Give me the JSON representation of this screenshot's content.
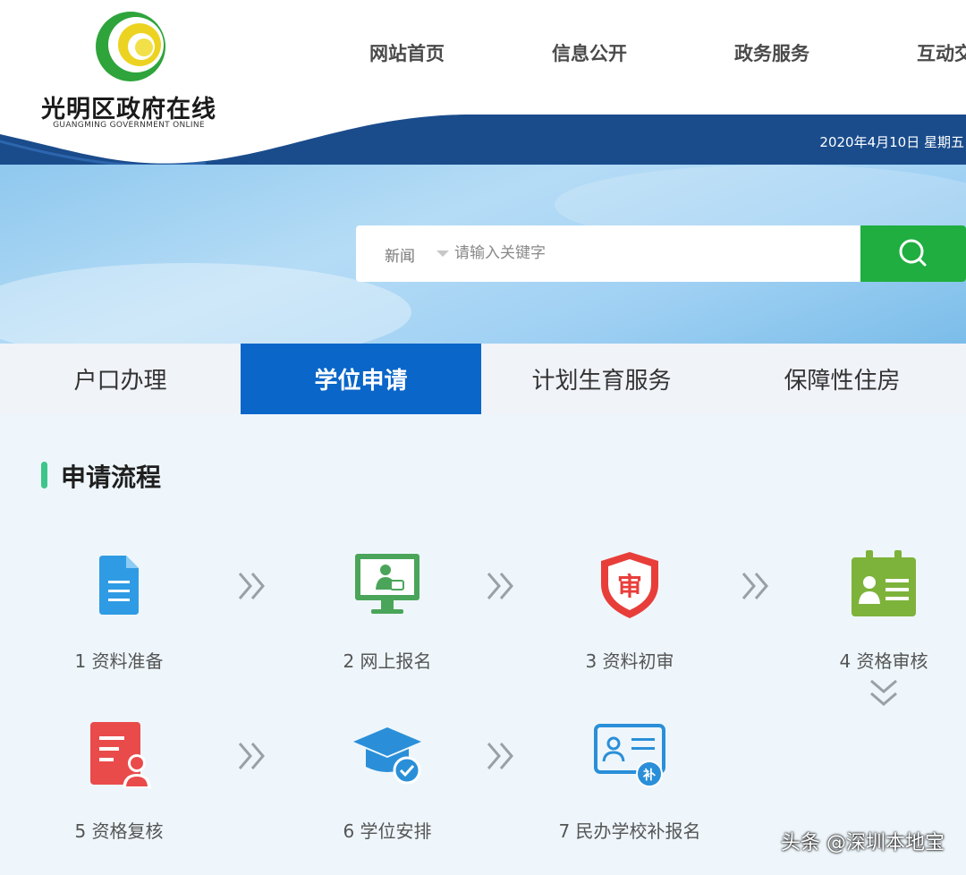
{
  "header": {
    "logo_title": "光明区政府在线",
    "logo_subtitle": "GUANGMING GOVERNMENT ONLINE",
    "nav": [
      "网站首页",
      "信息公开",
      "政务服务",
      "互动交"
    ],
    "date": "2020年4月10日 星期五"
  },
  "search": {
    "scope": "新闻",
    "placeholder": "请输入关键字",
    "value": ""
  },
  "tabs": [
    {
      "label": "户口办理",
      "active": false
    },
    {
      "label": "学位申请",
      "active": true
    },
    {
      "label": "计划生育服务",
      "active": false
    },
    {
      "label": "保障性住房",
      "active": false
    }
  ],
  "process": {
    "title": "申请流程",
    "steps": [
      {
        "label": "1 资料准备",
        "icon": "document-icon"
      },
      {
        "label": "2 网上报名",
        "icon": "online-register-icon"
      },
      {
        "label": "3 资料初审",
        "icon": "review-shield-icon"
      },
      {
        "label": "4 资格审核",
        "icon": "id-card-icon"
      },
      {
        "label": "5 资格复核",
        "icon": "recheck-icon"
      },
      {
        "label": "6 学位安排",
        "icon": "graduation-cap-icon"
      },
      {
        "label": "7 民办学校补报名",
        "icon": "supplement-card-icon"
      }
    ]
  },
  "watermark": "头条 @深圳本地宝",
  "colors": {
    "primary_blue": "#0a66c8",
    "header_navy": "#1a4c8c",
    "search_green": "#1fae3f",
    "accent_green": "#3ec58a"
  }
}
